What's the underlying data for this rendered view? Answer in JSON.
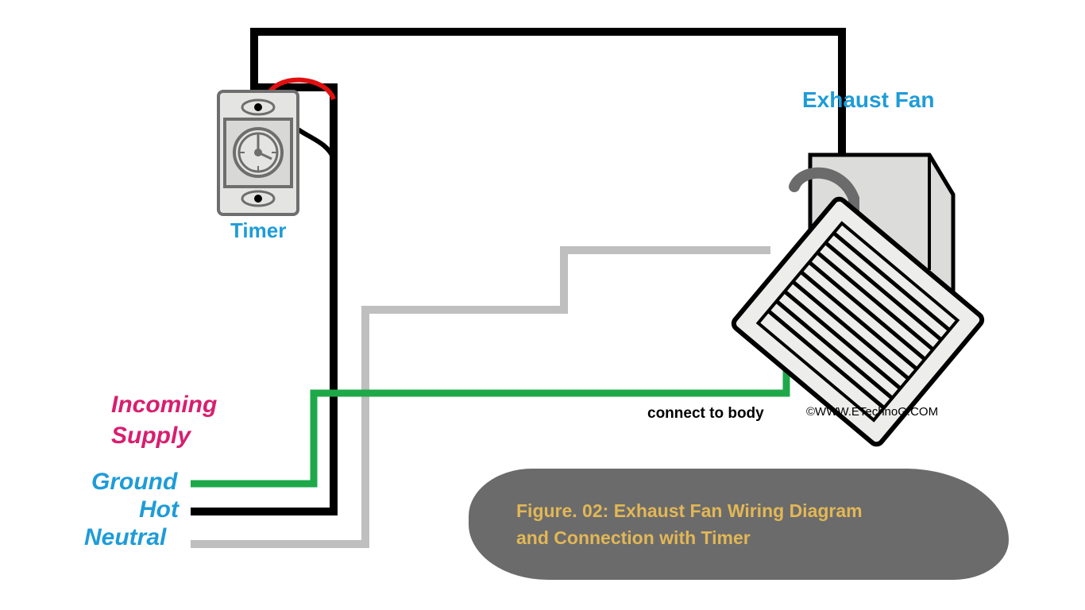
{
  "labels": {
    "timer": "Timer",
    "exhaust_fan": "Exhaust Fan",
    "incoming_supply_line1": "Incoming",
    "incoming_supply_line2": "Supply",
    "ground": "Ground",
    "hot": "Hot",
    "neutral": "Neutral",
    "connect_to_body": "connect to body",
    "watermark": "©WWW.ETechnoG.COM"
  },
  "caption": {
    "line1": "Figure. 02: Exhaust Fan Wiring Diagram",
    "line2": "and Connection with Timer"
  },
  "wires": {
    "ground_color": "#1ea84a",
    "hot_color": "#000000",
    "neutral_color": "#bfbfbf",
    "switched_color": "#e01010",
    "conduit_color": "#6b6b6b"
  },
  "components": [
    "Timer Switch",
    "Exhaust Fan"
  ]
}
